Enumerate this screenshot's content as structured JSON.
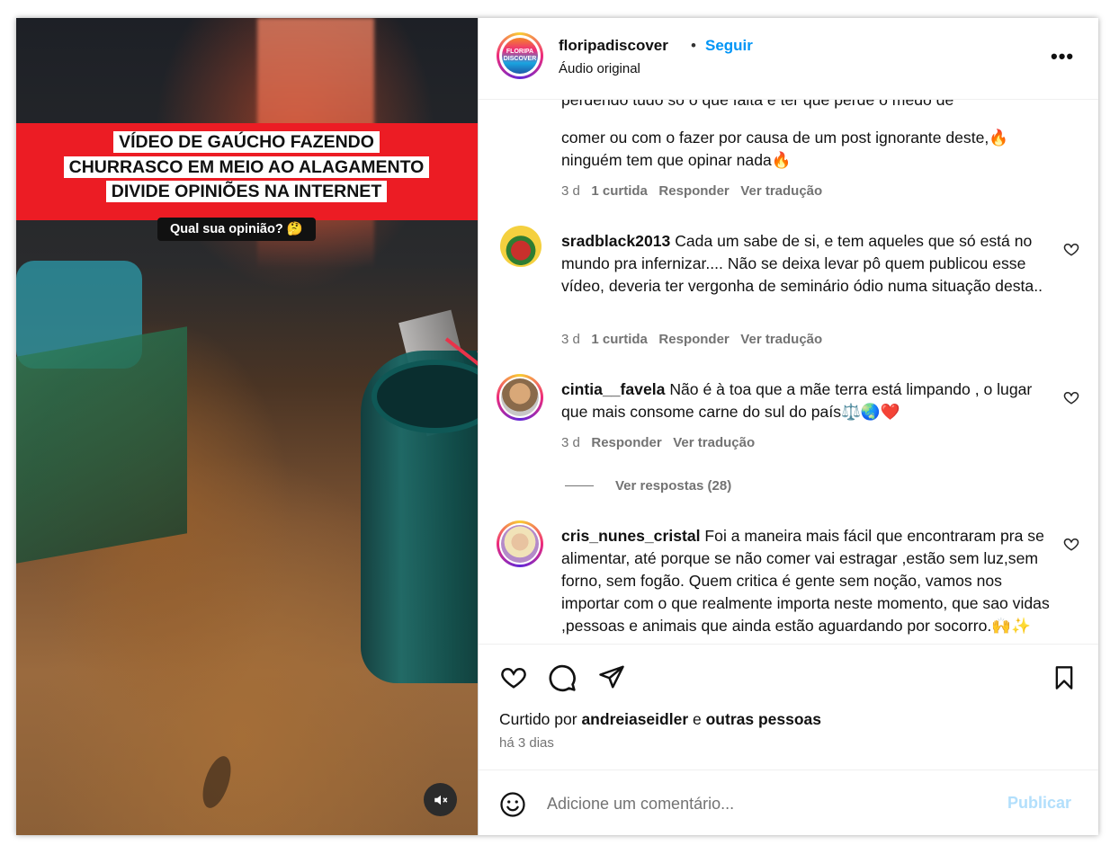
{
  "video": {
    "headline_lines": [
      "VÍDEO DE GAÚCHO FAZENDO",
      "CHURRASCO EM MEIO AO ALAGAMENTO",
      "DIVIDE OPINIÕES NA INTERNET"
    ],
    "question": "Qual sua opinião?",
    "question_emoji": "🤔",
    "mute_icon": "speaker-muted-icon"
  },
  "header": {
    "username": "floripadiscover",
    "separator": "•",
    "follow_label": "Seguir",
    "subtitle": "Áudio original",
    "avatar_text_line1": "FLORIPA",
    "avatar_text_line2": "DISCOVER",
    "more_label": "•••"
  },
  "comments": {
    "partial": {
      "clipped_line": "perdendo tudo só o que falta é ter que perde o medo de",
      "text": "comer ou com o fazer por causa de um post ignorante deste,🔥ninguém tem que opinar nada🔥",
      "time": "3 d",
      "likes": "1 curtida",
      "reply": "Responder",
      "translate": "Ver tradução"
    },
    "items": [
      {
        "username": "sradblack2013",
        "text": "Cada um sabe de si, e tem aqueles que só está no mundo pra infernizar.... Não se deixa levar pô quem publicou esse vídeo, deveria ter vergonha de seminário ódio numa situação desta..",
        "time": "3 d",
        "likes": "1 curtida",
        "reply": "Responder",
        "translate": "Ver tradução"
      },
      {
        "username": "cintia__favela",
        "text": "Não é à toa que a mãe terra está limpando , o lugar que mais consome carne do sul do país⚖️🌏❤️",
        "time": "3 d",
        "reply": "Responder",
        "translate": "Ver tradução",
        "view_replies": "Ver respostas (28)"
      },
      {
        "username": "cris_nunes_cristal",
        "text": "Foi a maneira mais fácil que encontraram pra se alimentar, até porque se não comer vai estragar ,estão sem luz,sem forno, sem fogão. Quem critica é gente sem noção, vamos nos importar com o que realmente importa neste momento, que sao vidas ,pessoas e animais que ainda estão aguardando por socorro.🙌✨"
      }
    ]
  },
  "actions": {
    "liked_prefix": "Curtido por",
    "liked_user": "andreiaseidler",
    "liked_and": "e",
    "liked_others": "outras pessoas",
    "posted_ago": "há 3 dias"
  },
  "composer": {
    "placeholder": "Adicione um comentário...",
    "publish_label": "Publicar"
  },
  "colors": {
    "accent_blue": "#0095f6",
    "publish_disabled": "#b2dffc",
    "headline_band": "#ec1c24",
    "muted_text": "#737373"
  }
}
